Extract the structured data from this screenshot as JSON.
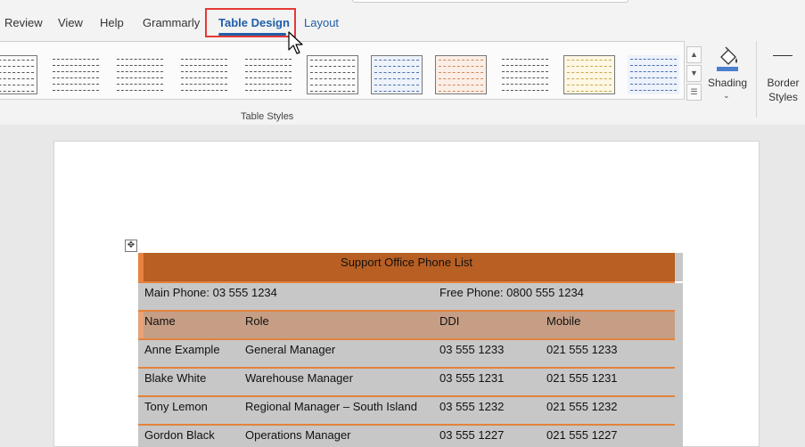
{
  "tabs": [
    {
      "label": "Review"
    },
    {
      "label": "View"
    },
    {
      "label": "Help"
    },
    {
      "label": "Grammarly"
    },
    {
      "label": "Table Design",
      "active": true
    },
    {
      "label": "Layout"
    }
  ],
  "ribbon": {
    "group_label": "Table Styles",
    "shading_label": "Shading",
    "border_styles_line1": "Border",
    "border_styles_line2": "Styles",
    "gallery_styles": [
      "plain-grid",
      "dashed-lines",
      "header-lines",
      "plain-dashed",
      "header-dashed",
      "grid-table",
      "blue-grid",
      "orange-grid",
      "banded-lines",
      "yellow-grid",
      "blue-lines"
    ]
  },
  "table": {
    "title": "Support Office Phone List",
    "main_phone": "Main Phone: 03 555 1234",
    "free_phone": "Free Phone: 0800 555 1234",
    "headers": [
      "Name",
      "Role",
      "DDI",
      "Mobile"
    ],
    "rows": [
      [
        "Anne Example",
        "General Manager",
        "03 555 1233",
        "021 555 1233"
      ],
      [
        "Blake White",
        "Warehouse Manager",
        "03 555 1231",
        "021 555 1231"
      ],
      [
        "Tony Lemon",
        "Regional Manager – South Island",
        "03 555 1232",
        "021 555 1232"
      ],
      [
        "Gordon Black",
        "Operations Manager",
        "03 555 1227",
        "021 555 1227"
      ]
    ]
  },
  "colors": {
    "accent": "#1f5ea8",
    "title_fill": "#b85f23",
    "header_fill": "#c59e85",
    "row_fill": "#c7c7c7",
    "row_border": "#e3823d",
    "highlight_box": "#e53935"
  }
}
